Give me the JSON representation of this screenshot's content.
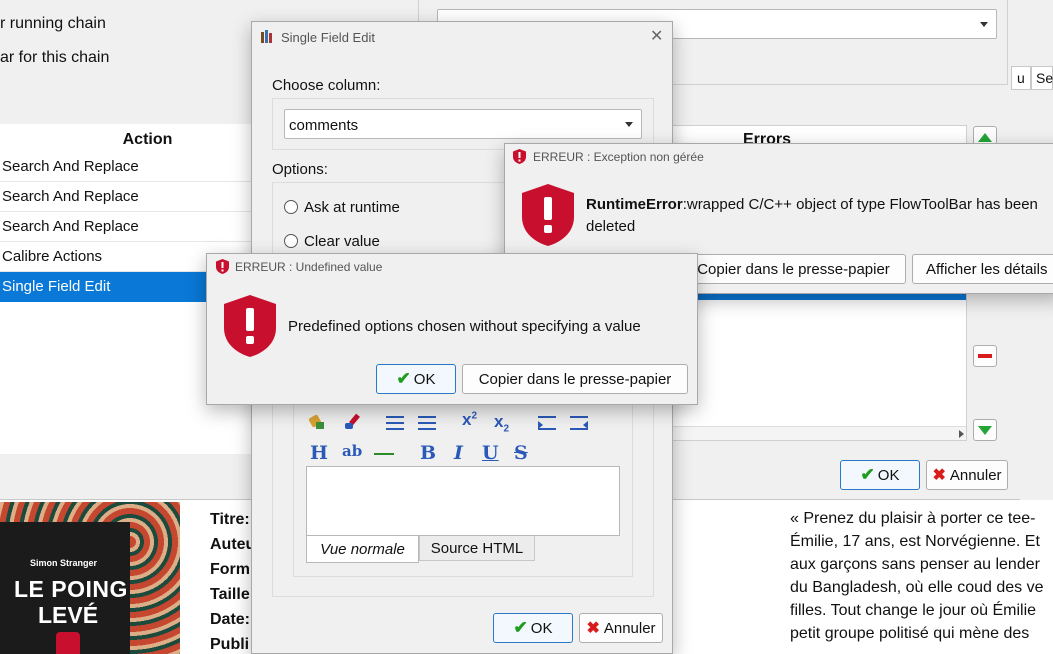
{
  "background": {
    "top_left_line1": "r running chain",
    "top_left_line2": "ar for this chain",
    "table_header_action": "Action",
    "table_header_errors": "Errors",
    "col_u": "u",
    "col_se": "Se",
    "actions": [
      "Search And Replace",
      "Search And Replace",
      "Search And Replace",
      "Calibre Actions",
      "Single Field Edit"
    ],
    "selected_index": 4,
    "ok_label": "OK",
    "cancel_label": "Annuler"
  },
  "book_details": {
    "cover_author": "Simon Stranger",
    "cover_title_line1": "LE POING",
    "cover_title_line2": "LEVÉ",
    "field_labels": [
      "Titre:",
      "Auteu",
      "Form",
      "Taille",
      "Date:",
      "Publi"
    ],
    "description": [
      "« Prenez du plaisir à porter ce tee-",
      "Émilie, 17 ans, est Norvégienne. Et",
      "aux garçons sans penser au lender",
      "du Bangladesh, où elle coud des ve",
      "filles. Tout change le jour où Émilie",
      "petit groupe politisé qui mène des"
    ]
  },
  "single_field_edit": {
    "title": "Single Field Edit",
    "choose_column_label": "Choose column:",
    "column_value": "comments",
    "options_label": "Options:",
    "radio_ask": "Ask at runtime",
    "radio_clear": "Clear value",
    "tab_normal": "Vue normale",
    "tab_html": "Source HTML",
    "ok_label": "OK",
    "cancel_label": "Annuler"
  },
  "error_exception": {
    "title": "ERREUR : Exception non gérée",
    "error_type": "RuntimeError",
    "message_rest": ":wrapped C/C++ object of type FlowToolBar has been",
    "message_line2": "deleted",
    "ok_label": "OK",
    "copy_label": "Copier dans le presse-papier",
    "details_label": "Afficher les détails"
  },
  "error_undefined": {
    "title": "ERREUR : Undefined value",
    "message": "Predefined options chosen without specifying a value",
    "ok_label": "OK",
    "copy_label": "Copier dans le presse-papier"
  },
  "colors": {
    "selection": "#0a78d7",
    "error_red": "#c8102e",
    "ok_green": "#1f9d1f"
  }
}
